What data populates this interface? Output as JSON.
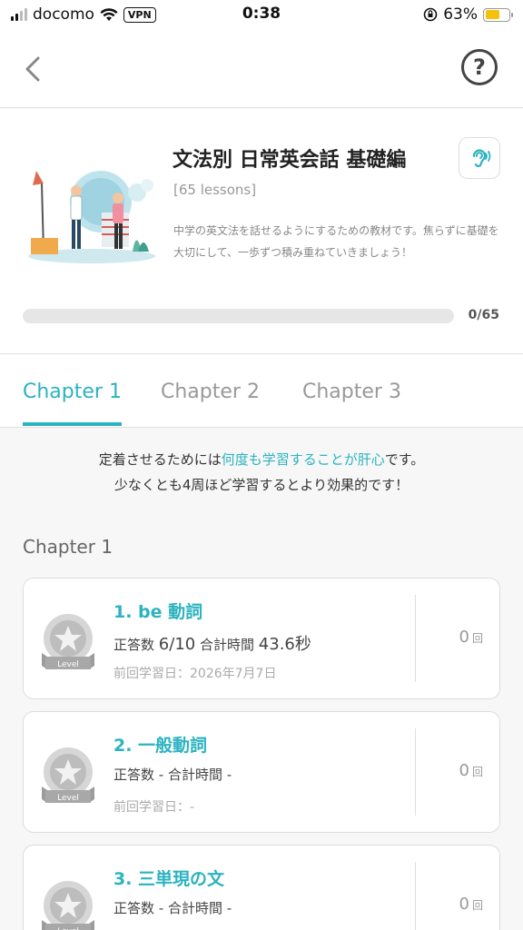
{
  "status_bar": {
    "carrier": "docomo",
    "vpn": "VPN",
    "time": "0:38",
    "battery": "63%"
  },
  "course": {
    "title": "文法別 日常英会話 基礎編",
    "lessons": "[65 lessons]",
    "description": "中学の英文法を話せるようにするための教材です。焦らずに基礎を大切にして、一歩ずつ積み重ねていきましょう！",
    "progress_text": "0/65",
    "progress_fraction": 0
  },
  "tabs": [
    "Chapter 1",
    "Chapter 2",
    "Chapter 3"
  ],
  "notice": {
    "line1_pre": "定着させるためには",
    "line1_highlight": "何度も学習することが肝心",
    "line1_post": "です。",
    "line2": "少なくとも4周ほど学習するとより効果的です！"
  },
  "section_title": "Chapter 1",
  "lessons": [
    {
      "title": "1. be 動詞",
      "correct_label": "正答数",
      "correct_value": "6/10",
      "time_label": "合計時間",
      "time_value": "43.6秒",
      "last_study": "前回学習日：2026年7月7日",
      "count": "0",
      "count_unit": "回"
    },
    {
      "title": "2. 一般動詞",
      "correct_label": "正答数",
      "correct_value": "-",
      "time_label": "合計時間",
      "time_value": "-",
      "last_study": "前回学習日：-",
      "count": "0",
      "count_unit": "回"
    },
    {
      "title": "3. 三単現の文",
      "correct_label": "正答数",
      "correct_value": "-",
      "time_label": "合計時間",
      "time_value": "-",
      "last_study": "",
      "count": "0",
      "count_unit": "回"
    }
  ],
  "medal_label": "Level",
  "icons": {
    "back": "chevron-left-icon",
    "help": "question-circle-icon",
    "listen": "ear-icon",
    "medal": "star-medal-icon"
  },
  "colors": {
    "accent": "#2bb3c0",
    "battery": "#f4c20d"
  }
}
